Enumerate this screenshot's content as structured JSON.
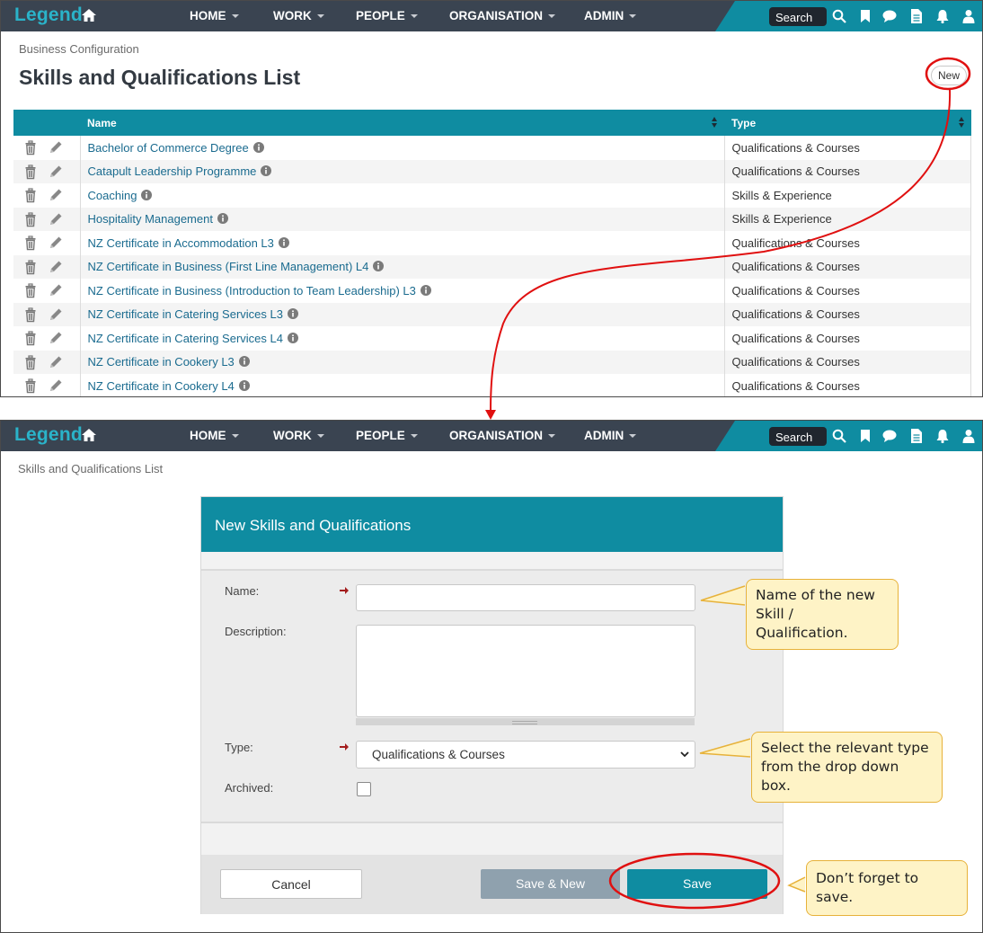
{
  "nav": {
    "logo": "Legend",
    "menu": [
      "HOME",
      "WORK",
      "PEOPLE",
      "ORGANISATION",
      "ADMIN"
    ],
    "search_label": "Search",
    "colors": {
      "navbar": "#3a4451",
      "accent": "#0f8ca1",
      "logo": "#2ab3c9"
    }
  },
  "list_page": {
    "breadcrumb": "Business Configuration",
    "title": "Skills and Qualifications List",
    "new_button": "New",
    "columns": {
      "name": "Name",
      "type": "Type"
    },
    "rows": [
      {
        "name": "Bachelor of Commerce Degree",
        "type": "Qualifications & Courses"
      },
      {
        "name": "Catapult Leadership Programme",
        "type": "Qualifications & Courses"
      },
      {
        "name": "Coaching",
        "type": "Skills & Experience"
      },
      {
        "name": "Hospitality Management",
        "type": "Skills & Experience"
      },
      {
        "name": "NZ Certificate in Accommodation L3",
        "type": "Qualifications & Courses"
      },
      {
        "name": "NZ Certificate in Business (First Line Management) L4",
        "type": "Qualifications & Courses"
      },
      {
        "name": "NZ Certificate in Business (Introduction to Team Leadership) L3",
        "type": "Qualifications & Courses"
      },
      {
        "name": "NZ Certificate in Catering Services L3",
        "type": "Qualifications & Courses"
      },
      {
        "name": "NZ Certificate in Catering Services L4",
        "type": "Qualifications & Courses"
      },
      {
        "name": "NZ Certificate in Cookery L3",
        "type": "Qualifications & Courses"
      },
      {
        "name": "NZ Certificate in Cookery L4",
        "type": "Qualifications & Courses"
      }
    ]
  },
  "form_page": {
    "breadcrumb": "Skills and Qualifications List",
    "panel_title": "New Skills and Qualifications",
    "fields": {
      "name_label": "Name:",
      "name_value": "",
      "description_label": "Description:",
      "description_value": "",
      "type_label": "Type:",
      "type_value": "Qualifications & Courses",
      "archived_label": "Archived:",
      "archived_checked": false
    },
    "buttons": {
      "cancel": "Cancel",
      "save_new": "Save & New",
      "save": "Save"
    }
  },
  "callouts": {
    "name_line1": "Name of the new",
    "name_line2": "Skill / Qualification.",
    "type_line1": "Select the relevant type",
    "type_line2": "from the drop down box.",
    "save": "Don’t forget to save."
  }
}
